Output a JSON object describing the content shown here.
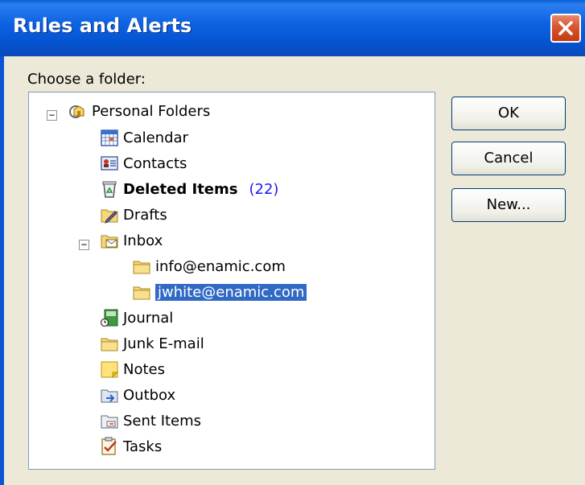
{
  "window": {
    "title": "Rules and Alerts"
  },
  "dialog": {
    "prompt": "Choose a folder:",
    "buttons": {
      "ok": "OK",
      "cancel": "Cancel",
      "new": "New..."
    }
  },
  "tree": {
    "root": "Personal Folders",
    "items": [
      {
        "label": "Calendar",
        "icon": "calendar-icon"
      },
      {
        "label": "Contacts",
        "icon": "contacts-icon"
      },
      {
        "label": "Deleted Items",
        "count": "(22)",
        "icon": "deleted-items-icon"
      },
      {
        "label": "Drafts",
        "icon": "drafts-icon"
      },
      {
        "label": "Inbox",
        "icon": "inbox-icon",
        "expanded": true
      },
      {
        "label": "info@enamic.com",
        "icon": "folder-icon"
      },
      {
        "label": "jwhite@enamic.com",
        "icon": "folder-icon",
        "selected": true
      },
      {
        "label": "Journal",
        "icon": "journal-icon"
      },
      {
        "label": "Junk E-mail",
        "icon": "folder-icon"
      },
      {
        "label": "Notes",
        "icon": "notes-icon"
      },
      {
        "label": "Outbox",
        "icon": "outbox-icon"
      },
      {
        "label": "Sent Items",
        "icon": "sent-items-icon"
      },
      {
        "label": "Tasks",
        "icon": "tasks-icon"
      }
    ]
  },
  "colors": {
    "titlebar": "#0454d2",
    "selection": "#316ac5",
    "count": "#1a1af0"
  }
}
